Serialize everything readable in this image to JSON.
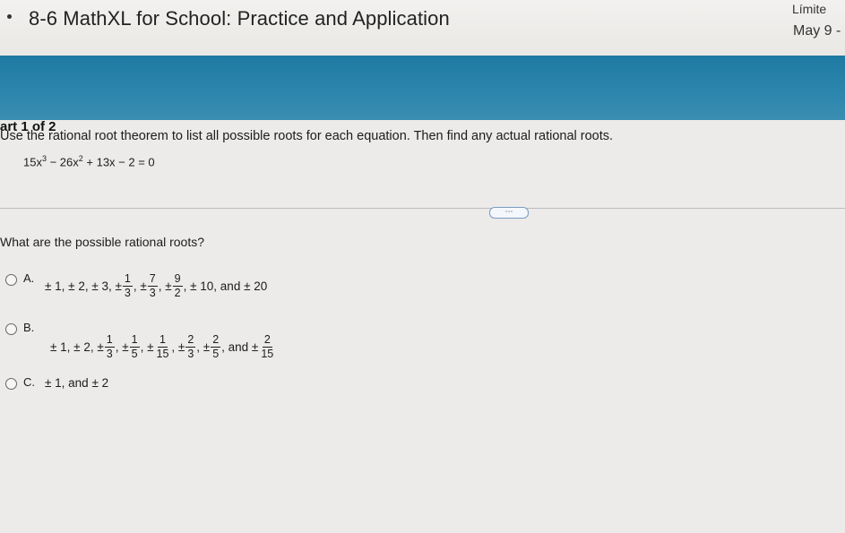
{
  "header": {
    "title": "8-6 MathXL for School: Practice and Application",
    "limit_label": "Límite",
    "limit_date": "May 9 -"
  },
  "part": {
    "label": "art 1 of 2"
  },
  "problem": {
    "instruction": "Use the rational root theorem to list all possible roots for each equation. Then find any actual rational roots.",
    "equation": {
      "t1": "15x",
      "e1": "3",
      "t2": " − 26x",
      "e2": "2",
      "t3": " + 13x − 2 = 0"
    },
    "more_button": "⋯"
  },
  "question": "What are the possible rational roots?",
  "options": {
    "a": {
      "letter": "A.",
      "p1": "± 1,  ± 2,  ± 3,  ±",
      "f1": {
        "n": "1",
        "d": "3"
      },
      "s1": ",  ±",
      "f2": {
        "n": "7",
        "d": "3"
      },
      "s2": ",  ±",
      "f3": {
        "n": "9",
        "d": "2"
      },
      "tail": ",  ± 10, and ± 20"
    },
    "b": {
      "letter": "B.",
      "p1": "± 1,  ± 2,  ±",
      "f1": {
        "n": "1",
        "d": "3"
      },
      "s1": ",  ±",
      "f2": {
        "n": "1",
        "d": "5"
      },
      "s2": ",  ±",
      "f3": {
        "n": "1",
        "d": "15"
      },
      "s3": ",  ±",
      "f4": {
        "n": "2",
        "d": "3"
      },
      "s4": ",  ±",
      "f5": {
        "n": "2",
        "d": "5"
      },
      "s5": ", and ±",
      "f6": {
        "n": "2",
        "d": "15"
      }
    },
    "c": {
      "letter": "C.",
      "text": "± 1, and ± 2"
    }
  }
}
